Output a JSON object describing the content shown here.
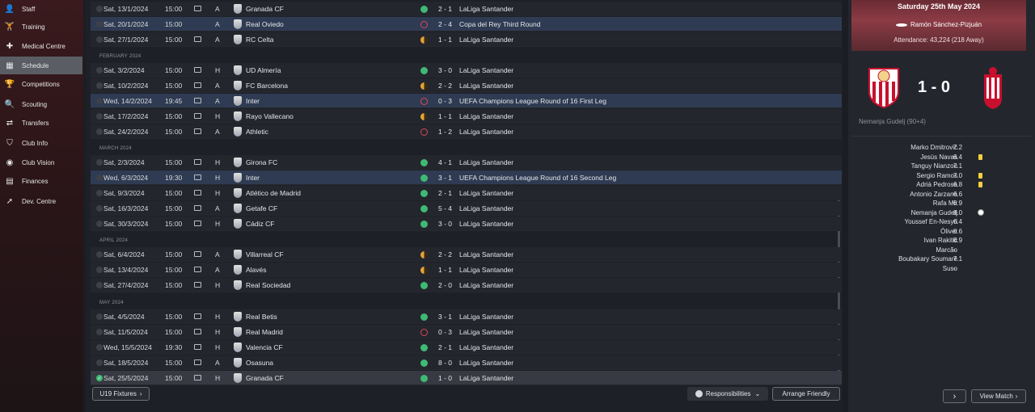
{
  "sidebar": {
    "items": [
      {
        "label": "Staff",
        "icon": "staff-icon"
      },
      {
        "label": "Training",
        "icon": "training-icon"
      },
      {
        "label": "Medical Centre",
        "icon": "medical-icon"
      },
      {
        "label": "Schedule",
        "icon": "calendar-icon",
        "active": true
      },
      {
        "label": "Competitions",
        "icon": "trophy-icon"
      },
      {
        "label": "Scouting",
        "icon": "search-icon"
      },
      {
        "label": "Transfers",
        "icon": "transfer-icon"
      },
      {
        "label": "Club Info",
        "icon": "shield-icon"
      },
      {
        "label": "Club Vision",
        "icon": "vision-icon"
      },
      {
        "label": "Finances",
        "icon": "finance-icon"
      },
      {
        "label": "Dev. Centre",
        "icon": "dev-icon"
      }
    ]
  },
  "months": [
    "FEBRUARY 2024",
    "MARCH 2024",
    "APRIL 2024",
    "MAY 2024"
  ],
  "fixtures": [
    {
      "date": "Sat, 13/1/2024",
      "time": "15:00",
      "tv": true,
      "ha": "A",
      "opp": "Granada CF",
      "res": "W",
      "score": "2 - 1",
      "comp": "LaLiga Santander"
    },
    {
      "date": "Sat, 20/1/2024",
      "time": "15:00",
      "tv": false,
      "ha": "A",
      "opp": "Real Oviedo",
      "res": "L",
      "score": "2 - 4",
      "comp": "Copa del Rey Third Round"
    },
    {
      "date": "Sat, 27/1/2024",
      "time": "15:00",
      "tv": true,
      "ha": "A",
      "opp": "RC Celta",
      "res": "D",
      "score": "1 - 1",
      "comp": "LaLiga Santander"
    },
    {
      "date": "Sat, 3/2/2024",
      "time": "15:00",
      "tv": true,
      "ha": "H",
      "opp": "UD Almería",
      "res": "W",
      "score": "3 - 0",
      "comp": "LaLiga Santander"
    },
    {
      "date": "Sat, 10/2/2024",
      "time": "15:00",
      "tv": true,
      "ha": "A",
      "opp": "FC Barcelona",
      "res": "D",
      "score": "2 - 2",
      "comp": "LaLiga Santander"
    },
    {
      "date": "Wed, 14/2/2024",
      "time": "19:45",
      "tv": true,
      "ha": "A",
      "opp": "Inter",
      "res": "L",
      "score": "0 - 3",
      "comp": "UEFA Champions League Round of 16  First Leg"
    },
    {
      "date": "Sat, 17/2/2024",
      "time": "15:00",
      "tv": true,
      "ha": "H",
      "opp": "Rayo Vallecano",
      "res": "D",
      "score": "1 - 1",
      "comp": "LaLiga Santander"
    },
    {
      "date": "Sat, 24/2/2024",
      "time": "15:00",
      "tv": true,
      "ha": "A",
      "opp": "Athletic",
      "res": "L",
      "score": "1 - 2",
      "comp": "LaLiga Santander"
    },
    {
      "date": "Sat, 2/3/2024",
      "time": "15:00",
      "tv": true,
      "ha": "H",
      "opp": "Girona FC",
      "res": "W",
      "score": "4 - 1",
      "comp": "LaLiga Santander"
    },
    {
      "date": "Wed, 6/3/2024",
      "time": "19:30",
      "tv": true,
      "ha": "H",
      "opp": "Inter",
      "res": "W",
      "score": "3 - 1",
      "comp": "UEFA Champions League Round of 16  Second Leg"
    },
    {
      "date": "Sat, 9/3/2024",
      "time": "15:00",
      "tv": true,
      "ha": "H",
      "opp": "Atlético de Madrid",
      "res": "W",
      "score": "2 - 1",
      "comp": "LaLiga Santander"
    },
    {
      "date": "Sat, 16/3/2024",
      "time": "15:00",
      "tv": true,
      "ha": "A",
      "opp": "Getafe CF",
      "res": "W",
      "score": "5 - 4",
      "comp": "LaLiga Santander"
    },
    {
      "date": "Sat, 30/3/2024",
      "time": "15:00",
      "tv": true,
      "ha": "H",
      "opp": "Cádiz CF",
      "res": "W",
      "score": "3 - 0",
      "comp": "LaLiga Santander"
    },
    {
      "date": "Sat, 6/4/2024",
      "time": "15:00",
      "tv": true,
      "ha": "A",
      "opp": "Villarreal CF",
      "res": "D",
      "score": "2 - 2",
      "comp": "LaLiga Santander"
    },
    {
      "date": "Sat, 13/4/2024",
      "time": "15:00",
      "tv": true,
      "ha": "A",
      "opp": "Alavés",
      "res": "D",
      "score": "1 - 1",
      "comp": "LaLiga Santander"
    },
    {
      "date": "Sat, 27/4/2024",
      "time": "15:00",
      "tv": true,
      "ha": "H",
      "opp": "Real Sociedad",
      "res": "W",
      "score": "2 - 0",
      "comp": "LaLiga Santander"
    },
    {
      "date": "Sat, 4/5/2024",
      "time": "15:00",
      "tv": true,
      "ha": "H",
      "opp": "Real Betis",
      "res": "W",
      "score": "3 - 1",
      "comp": "LaLiga Santander"
    },
    {
      "date": "Sat, 11/5/2024",
      "time": "15:00",
      "tv": true,
      "ha": "H",
      "opp": "Real Madrid",
      "res": "L",
      "score": "0 - 3",
      "comp": "LaLiga Santander"
    },
    {
      "date": "Wed, 15/5/2024",
      "time": "19:30",
      "tv": true,
      "ha": "H",
      "opp": "Valencia CF",
      "res": "W",
      "score": "2 - 1",
      "comp": "LaLiga Santander"
    },
    {
      "date": "Sat, 18/5/2024",
      "time": "15:00",
      "tv": true,
      "ha": "A",
      "opp": "Osasuna",
      "res": "W",
      "score": "8 - 0",
      "comp": "LaLiga Santander"
    },
    {
      "date": "Sat, 25/5/2024",
      "time": "15:00",
      "tv": true,
      "ha": "H",
      "opp": "Granada CF",
      "res": "W",
      "score": "1 - 0",
      "comp": "LaLiga Santander"
    }
  ],
  "bottom": {
    "u19": "U19 Fixtures",
    "responsibilities": "Responsibilities",
    "arrange": "Arrange Friendly"
  },
  "match": {
    "date": "Saturday 25th May 2024",
    "stadium": "Ramón Sánchez-Pizjuán",
    "attendance": "Attendance: 43,224 (218 Away)",
    "score": "1 - 0",
    "scorer": "Nemanja Gudelj (90+4)",
    "lineup": [
      {
        "name": "Marko Dmitrović",
        "rating": "7.2",
        "event": ""
      },
      {
        "name": "Jesús Navas",
        "rating": "6.4",
        "event": "yellow"
      },
      {
        "name": "Tanguy Nianzou",
        "rating": "7.1",
        "event": ""
      },
      {
        "name": "Sergio Ramos",
        "rating": "7.0",
        "event": "yellow"
      },
      {
        "name": "Adrià Pedrosa",
        "rating": "6.8",
        "event": "yellow"
      },
      {
        "name": "Antonio Zarzana",
        "rating": "6.6",
        "event": ""
      },
      {
        "name": "Rafa Mir",
        "rating": "6.9",
        "event": ""
      },
      {
        "name": "Nemanja Gudelj",
        "rating": "8.0",
        "event": "goal"
      },
      {
        "name": "Youssef En-Nesyri",
        "rating": "6.4",
        "event": ""
      },
      {
        "name": "Óliver",
        "rating": "6.6",
        "event": ""
      },
      {
        "name": "Ivan Rakitić",
        "rating": "6.9",
        "event": ""
      },
      {
        "name": "Marcão",
        "rating": "-",
        "event": ""
      },
      {
        "name": "Boubakary Soumaré",
        "rating": "7.1",
        "event": ""
      },
      {
        "name": "Suso",
        "rating": "-",
        "event": ""
      }
    ],
    "next_label": "›",
    "view_match": "View Match"
  }
}
